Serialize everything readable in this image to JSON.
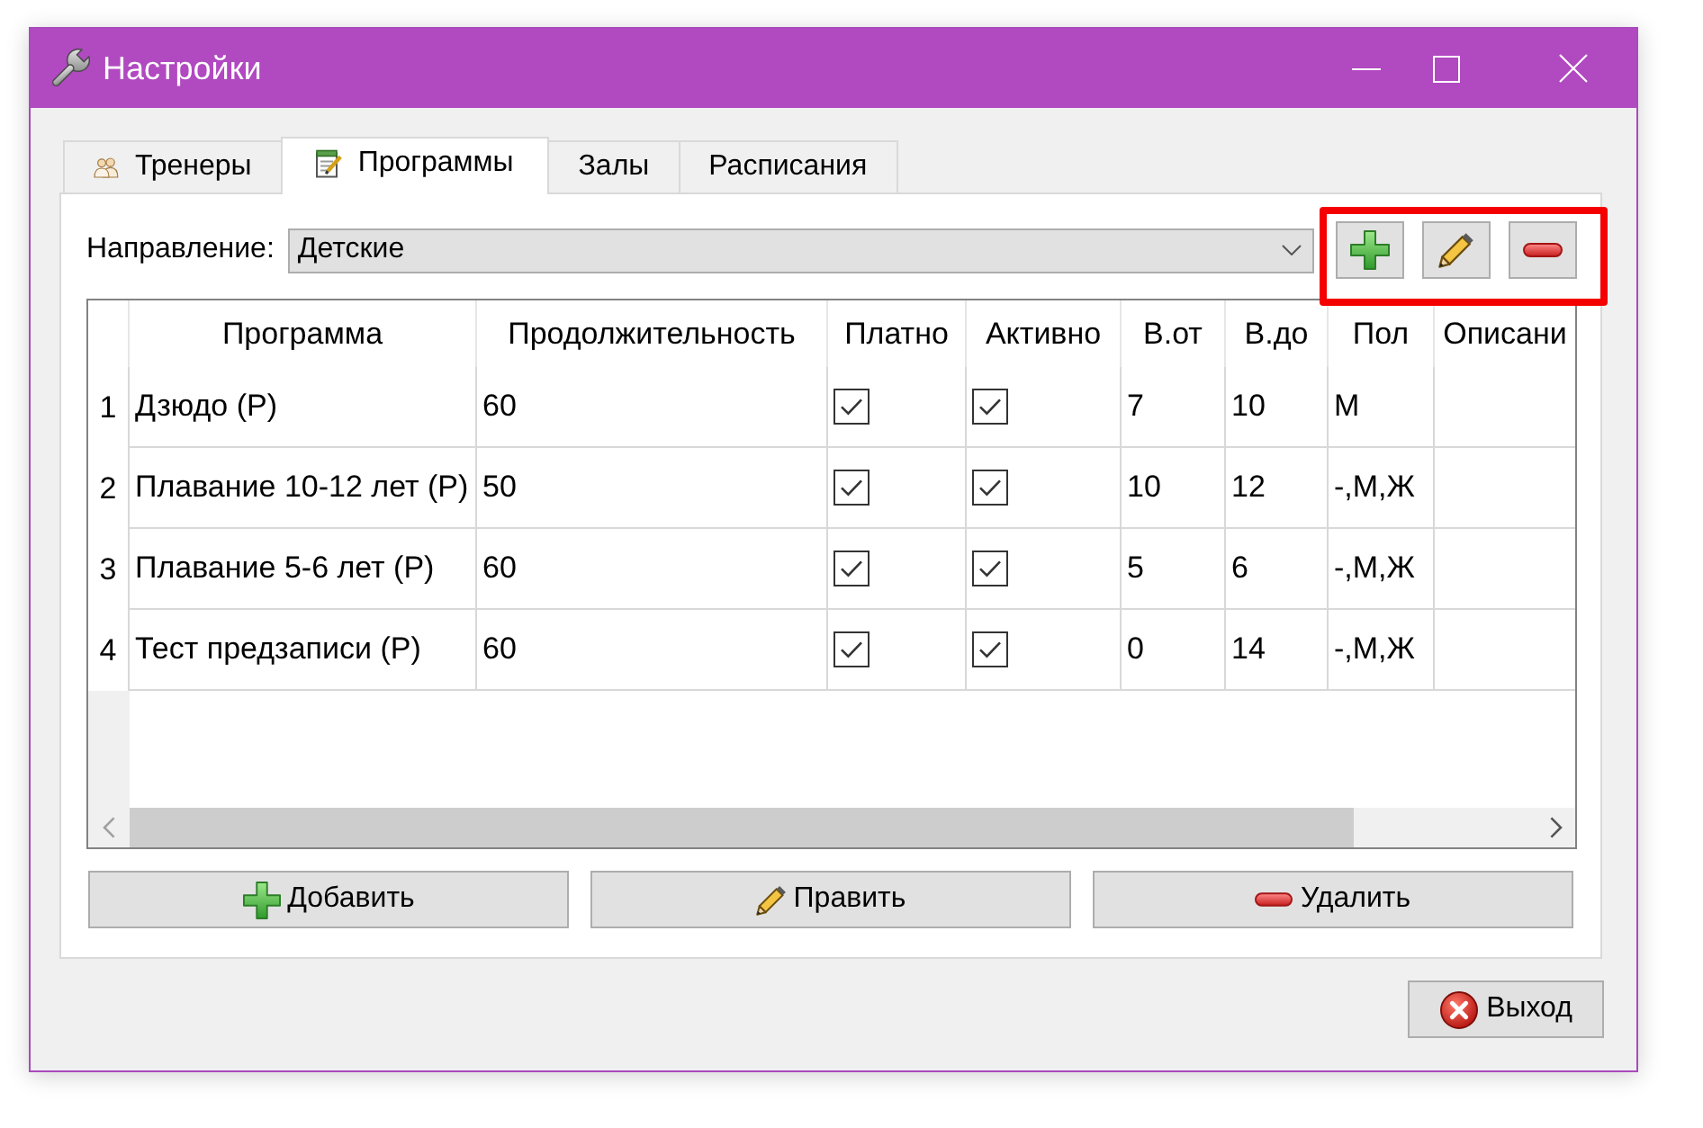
{
  "window": {
    "title": "Настройки"
  },
  "tabs": [
    {
      "label": "Тренеры",
      "selected": false
    },
    {
      "label": "Программы",
      "selected": true
    },
    {
      "label": "Залы",
      "selected": false
    },
    {
      "label": "Расписания",
      "selected": false
    }
  ],
  "direction": {
    "label": "Направление:",
    "value": "Детские"
  },
  "toolbar": [
    {
      "kind": "add"
    },
    {
      "kind": "edit"
    },
    {
      "kind": "delete"
    }
  ],
  "table": {
    "columns": [
      "Программа",
      "Продолжительность",
      "Платно",
      "Активно",
      "В.от",
      "В.до",
      "Пол",
      "Описани"
    ],
    "rows": [
      {
        "number": "1",
        "program": "Дзюдо (Р)",
        "duration": "60",
        "paid": true,
        "active": true,
        "age_from": "7",
        "age_to": "10",
        "gender": "М"
      },
      {
        "number": "2",
        "program": "Плавание 10-12 лет (Р)",
        "duration": "50",
        "paid": true,
        "active": true,
        "age_from": "10",
        "age_to": "12",
        "gender": "-,М,Ж"
      },
      {
        "number": "3",
        "program": "Плавание 5-6 лет (Р)",
        "duration": "60",
        "paid": true,
        "active": true,
        "age_from": "5",
        "age_to": "6",
        "gender": "-,М,Ж"
      },
      {
        "number": "4",
        "program": "Тест предзаписи (Р)",
        "duration": "60",
        "paid": true,
        "active": true,
        "age_from": "0",
        "age_to": "14",
        "gender": "-,М,Ж"
      }
    ]
  },
  "actions": [
    {
      "kind": "add",
      "label": "Добавить"
    },
    {
      "kind": "edit",
      "label": "Править"
    },
    {
      "kind": "delete",
      "label": "Удалить"
    }
  ],
  "exit_button": {
    "label": "Выход"
  }
}
